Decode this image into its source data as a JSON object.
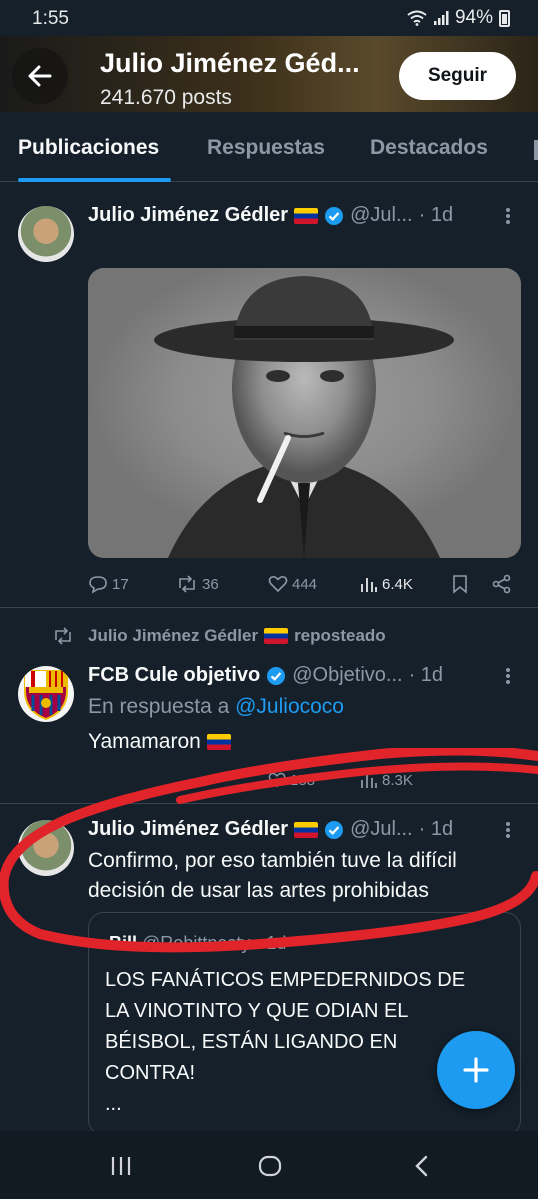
{
  "status_bar": {
    "time": "1:55",
    "battery": "94%",
    "icons": [
      "wifi-icon",
      "signal-icon",
      "battery-icon"
    ]
  },
  "header": {
    "title": "Julio Jiménez Géd...",
    "posts_count": "241.670 posts",
    "follow_label": "Seguir"
  },
  "tabs": [
    {
      "label": "Publicaciones",
      "active": true
    },
    {
      "label": "Respuestas",
      "active": false
    },
    {
      "label": "Destacados",
      "active": false
    }
  ],
  "tweets": [
    {
      "name": "Julio Jiménez Gédler",
      "handle": "@Jul...",
      "time": "· 1d",
      "stats": {
        "replies": "17",
        "reposts": "36",
        "likes": "444",
        "views": "6.4K"
      }
    },
    {
      "repost_label": "Julio Jiménez Gédler",
      "repost_suffix": "reposteado",
      "name": "FCB Cule objetivo",
      "handle": "@Objetivo...",
      "time": "· 1d",
      "reply_prefix": "En respuesta a",
      "reply_to": "@Juliococo",
      "text": "Yamamaron",
      "stats": {
        "likes": "158",
        "views": "8.3K"
      }
    },
    {
      "name": "Julio Jiménez Gédler",
      "handle": "@Jul...",
      "time": "· 1d",
      "text_line1": "Confirmo, por eso también tuve la difícil",
      "text_line2": "decisión de usar las artes prohibidas",
      "quote": {
        "author": "Bill",
        "handle": "@Robittnasty",
        "time": "· 1d",
        "line1": "LOS FANÁTICOS EMPEDERNIDOS DE",
        "line2": "LA VINOTINTO Y QUE ODIAN EL",
        "line3": "BÉISBOL, ESTÁN LIGANDO EN",
        "line4": "CONTRA!",
        "line5": "..."
      }
    }
  ],
  "colors": {
    "background": "#15202b",
    "accent": "#1d9bf0",
    "secondary_text": "#8b98a5",
    "annotation": "#e0242a"
  }
}
